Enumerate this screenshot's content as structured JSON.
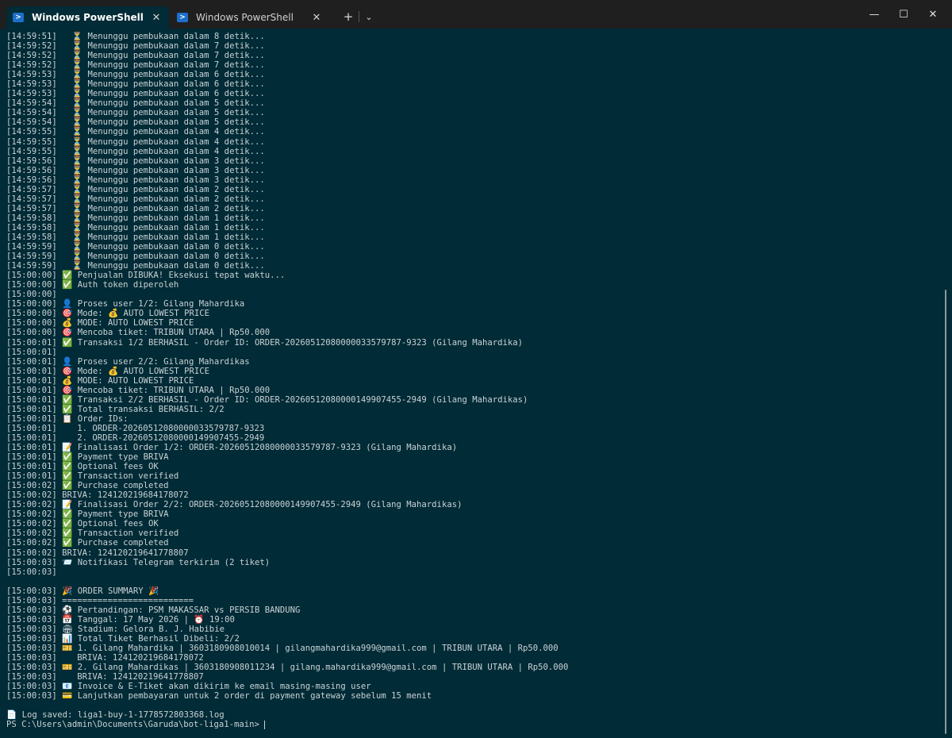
{
  "window": {
    "tabs": [
      {
        "label": "Windows PowerShell",
        "active": true
      },
      {
        "label": "Windows PowerShell",
        "active": false
      }
    ],
    "new_tab_icon": "plus-icon",
    "dropdown_icon": "chevron-down-icon"
  },
  "colors": {
    "terminal_bg": "#012b36",
    "titlebar_bg": "#1f1f1f",
    "text": "#c9d2d6",
    "ps_icon": "#1b6fc9"
  },
  "terminal": {
    "lines": [
      "[14:59:51]   ⏳ Menunggu pembukaan dalam 8 detik...",
      "[14:59:52]   ⏳ Menunggu pembukaan dalam 7 detik...",
      "[14:59:52]   ⏳ Menunggu pembukaan dalam 7 detik...",
      "[14:59:52]   ⏳ Menunggu pembukaan dalam 7 detik...",
      "[14:59:53]   ⏳ Menunggu pembukaan dalam 6 detik...",
      "[14:59:53]   ⏳ Menunggu pembukaan dalam 6 detik...",
      "[14:59:53]   ⏳ Menunggu pembukaan dalam 6 detik...",
      "[14:59:54]   ⏳ Menunggu pembukaan dalam 5 detik...",
      "[14:59:54]   ⏳ Menunggu pembukaan dalam 5 detik...",
      "[14:59:54]   ⏳ Menunggu pembukaan dalam 5 detik...",
      "[14:59:55]   ⏳ Menunggu pembukaan dalam 4 detik...",
      "[14:59:55]   ⏳ Menunggu pembukaan dalam 4 detik...",
      "[14:59:55]   ⏳ Menunggu pembukaan dalam 4 detik...",
      "[14:59:56]   ⏳ Menunggu pembukaan dalam 3 detik...",
      "[14:59:56]   ⏳ Menunggu pembukaan dalam 3 detik...",
      "[14:59:56]   ⏳ Menunggu pembukaan dalam 3 detik...",
      "[14:59:57]   ⏳ Menunggu pembukaan dalam 2 detik...",
      "[14:59:57]   ⏳ Menunggu pembukaan dalam 2 detik...",
      "[14:59:57]   ⏳ Menunggu pembukaan dalam 2 detik...",
      "[14:59:58]   ⏳ Menunggu pembukaan dalam 1 detik...",
      "[14:59:58]   ⏳ Menunggu pembukaan dalam 1 detik...",
      "[14:59:58]   ⏳ Menunggu pembukaan dalam 1 detik...",
      "[14:59:59]   ⏳ Menunggu pembukaan dalam 0 detik...",
      "[14:59:59]   ⏳ Menunggu pembukaan dalam 0 detik...",
      "[14:59:59]   ⏳ Menunggu pembukaan dalam 0 detik...",
      "[15:00:00] ✅ Penjualan DIBUKA! Eksekusi tepat waktu...",
      "[15:00:00] ✅ Auth token diperoleh",
      "[15:00:00]",
      "[15:00:00] 👤 Proses user 1/2: Gilang Mahardika",
      "[15:00:00] 🎯 Mode: 💰 AUTO LOWEST PRICE",
      "[15:00:00] 💰 MODE: AUTO LOWEST PRICE",
      "[15:00:00] 🎯 Mencoba tiket: TRIBUN UTARA | Rp50.000",
      "[15:00:01] ✅ Transaksi 1/2 BERHASIL - Order ID: ORDER-20260512080000033579787-9323 (Gilang Mahardika)",
      "[15:00:01]",
      "[15:00:01] 👤 Proses user 2/2: Gilang Mahardikas",
      "[15:00:01] 🎯 Mode: 💰 AUTO LOWEST PRICE",
      "[15:00:01] 💰 MODE: AUTO LOWEST PRICE",
      "[15:00:01] 🎯 Mencoba tiket: TRIBUN UTARA | Rp50.000",
      "[15:00:01] ✅ Transaksi 2/2 BERHASIL - Order ID: ORDER-20260512080000149907455-2949 (Gilang Mahardikas)",
      "[15:00:01] ✅ Total transaksi BERHASIL: 2/2",
      "[15:00:01] 📋 Order IDs:",
      "[15:00:01]    1. ORDER-20260512080000033579787-9323",
      "[15:00:01]    2. ORDER-20260512080000149907455-2949",
      "[15:00:01] 📝 Finalisasi Order 1/2: ORDER-20260512080000033579787-9323 (Gilang Mahardika)",
      "[15:00:01] ✅ Payment type BRIVA",
      "[15:00:01] ✅ Optional fees OK",
      "[15:00:01] ✅ Transaction verified",
      "[15:00:02] ✅ Purchase completed",
      "[15:00:02] BRIVA: 124120219684178072",
      "[15:00:02] 📝 Finalisasi Order 2/2: ORDER-20260512080000149907455-2949 (Gilang Mahardikas)",
      "[15:00:02] ✅ Payment type BRIVA",
      "[15:00:02] ✅ Optional fees OK",
      "[15:00:02] ✅ Transaction verified",
      "[15:00:02] ✅ Purchase completed",
      "[15:00:02] BRIVA: 124120219641778807",
      "[15:00:03] 📨 Notifikasi Telegram terkirim (2 tiket)",
      "[15:00:03]",
      "",
      "[15:00:03] 🎉 ORDER SUMMARY 🎉",
      "[15:00:03] ==========================",
      "[15:00:03] ⚽ Pertandingan: PSM MAKASSAR vs PERSIB BANDUNG",
      "[15:00:03] 📅 Tanggal: 17 May 2026 | ⏰ 19:00",
      "[15:00:03] 🏟 Stadium: Gelora B. J. Habibie",
      "[15:00:03] 📊 Total Tiket Berhasil Dibeli: 2/2",
      "[15:00:03] 🎫 1. Gilang Mahardika | 3603180908010014 | gilangmahardika999@gmail.com | TRIBUN UTARA | Rp50.000",
      "[15:00:03]    BRIVA: 124120219684178072",
      "[15:00:03] 🎫 2. Gilang Mahardikas | 3603180908011234 | gilang.mahardika999@gmail.com | TRIBUN UTARA | Rp50.000",
      "[15:00:03]    BRIVA: 124120219641778807",
      "[15:00:03] 📧 Invoice & E-Tiket akan dikirim ke email masing-masing user",
      "[15:00:03] 💳 Lanjutkan pembayaran untuk 2 order di payment gateway sebelum 15 menit",
      "",
      "📄 Log saved: liga1-buy-1-1778572803368.log"
    ],
    "prompt": "PS C:\\Users\\admin\\Documents\\Garuda\\bot-liga1-main> "
  }
}
